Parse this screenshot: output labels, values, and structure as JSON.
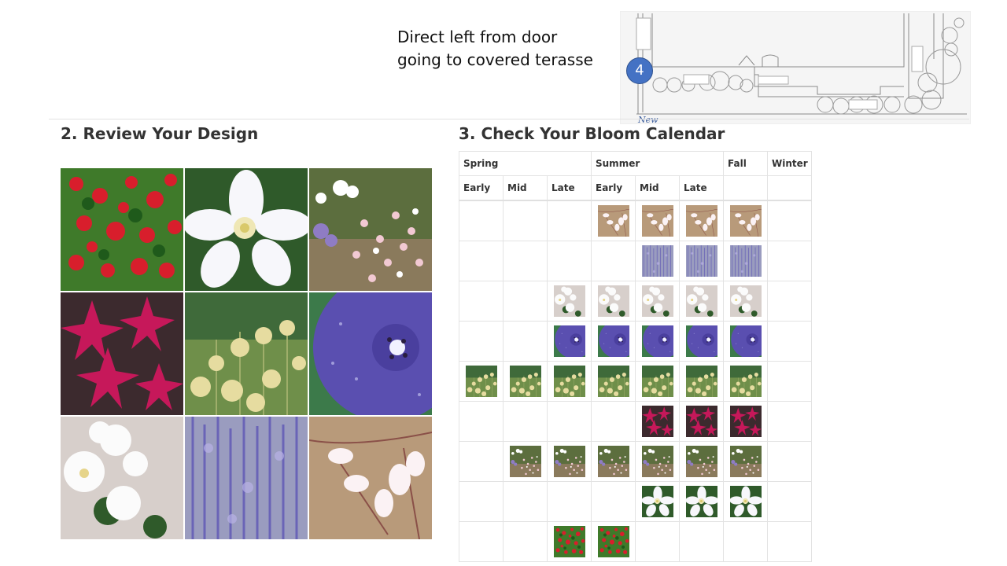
{
  "caption": {
    "line1": "Direct left from door",
    "line2": "going to covered terasse"
  },
  "plan": {
    "marker_number": "4",
    "note": "New"
  },
  "sections": {
    "review_title": "2. Review Your Design",
    "calendar_title": "3. Check Your Bloom Calendar"
  },
  "design_photos": [
    "red-rose",
    "white-clematis",
    "pink-white-daisies",
    "magenta-clematis",
    "yellow-buttons",
    "blue-geranium",
    "white-roses",
    "lavender-perovskia",
    "pink-gaura"
  ],
  "calendar": {
    "seasons": [
      "Spring",
      "Summer",
      "Fall",
      "Winter"
    ],
    "subperiods": [
      "Early",
      "Mid",
      "Late",
      "Early",
      "Mid",
      "Late",
      "",
      ""
    ],
    "rows": [
      {
        "plant": "pink-gaura",
        "bloom": [
          0,
          0,
          0,
          1,
          1,
          1,
          1,
          0
        ]
      },
      {
        "plant": "lavender-perovskia",
        "bloom": [
          0,
          0,
          0,
          0,
          1,
          1,
          1,
          0
        ]
      },
      {
        "plant": "white-roses",
        "bloom": [
          0,
          0,
          1,
          1,
          1,
          1,
          1,
          0
        ]
      },
      {
        "plant": "blue-geranium",
        "bloom": [
          0,
          0,
          1,
          1,
          1,
          1,
          1,
          0
        ]
      },
      {
        "plant": "yellow-buttons",
        "bloom": [
          1,
          1,
          1,
          1,
          1,
          1,
          1,
          0
        ]
      },
      {
        "plant": "magenta-clematis",
        "bloom": [
          0,
          0,
          0,
          0,
          1,
          1,
          1,
          0
        ]
      },
      {
        "plant": "pink-white-daisies",
        "bloom": [
          0,
          1,
          1,
          1,
          1,
          1,
          1,
          0
        ]
      },
      {
        "plant": "white-clematis",
        "bloom": [
          0,
          0,
          0,
          0,
          1,
          1,
          1,
          0
        ]
      },
      {
        "plant": "red-rose",
        "bloom": [
          0,
          0,
          1,
          1,
          0,
          0,
          0,
          0
        ]
      }
    ]
  }
}
